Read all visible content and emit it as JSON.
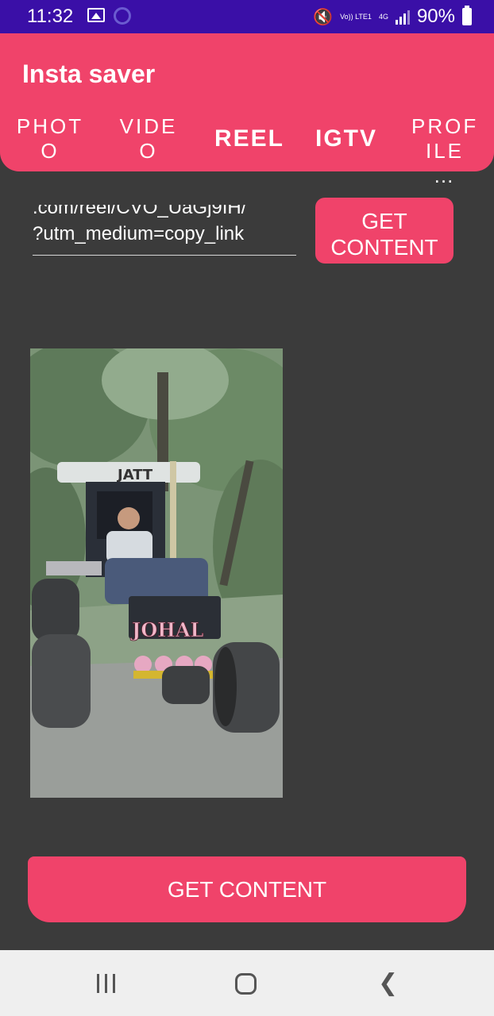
{
  "status_bar": {
    "time": "11:32",
    "volte": "Vo)) LTE1",
    "network": "4G",
    "battery": "90%"
  },
  "header": {
    "title": "Insta saver",
    "tabs": [
      {
        "line1": "PHOT",
        "line2": "O"
      },
      {
        "line1": "VIDE",
        "line2": "O"
      },
      {
        "line1": "REEL",
        "line2": ""
      },
      {
        "line1": "IGTV",
        "line2": ""
      },
      {
        "line1": "PROF",
        "line2": "ILE …"
      }
    ]
  },
  "url_input": {
    "line1": ".com/reel/CVO_UaGj9IH/",
    "line2": "?utm_medium=copy_link"
  },
  "buttons": {
    "get_content_small_line1": "GET",
    "get_content_small_line2": "CONTENT",
    "get_content_big": "GET CONTENT"
  },
  "preview": {
    "sign_text": "JOHAL",
    "roof_text": "JATT"
  },
  "colors": {
    "accent": "#f0436a",
    "status_bar": "#3a0fa7",
    "background": "#3b3b3b"
  }
}
